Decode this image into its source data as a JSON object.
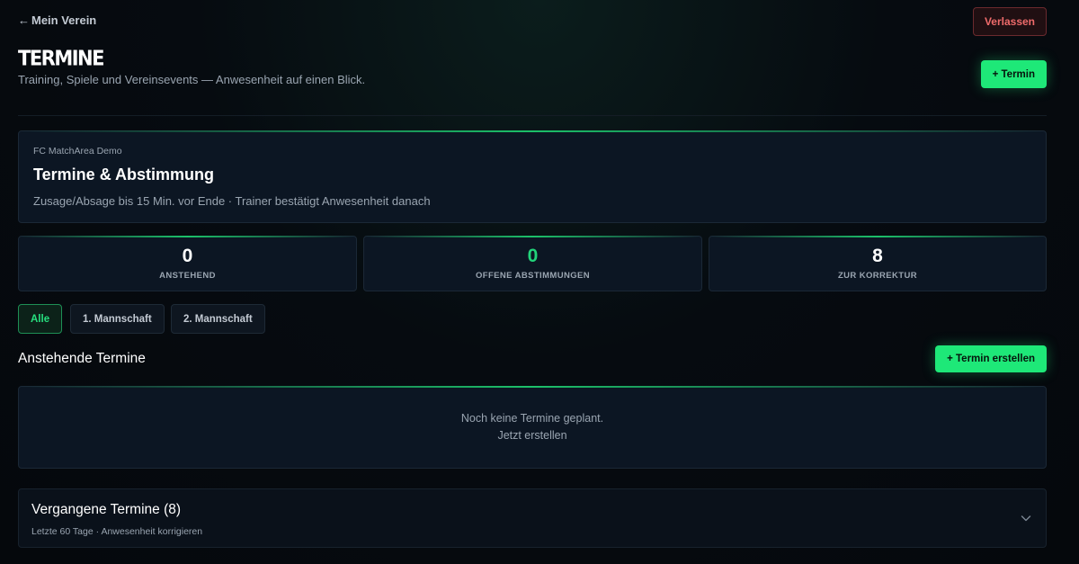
{
  "header": {
    "back_arrow": "←",
    "back_label": "Mein Verein",
    "leave_label": "Verlassen",
    "title": "TERMINE",
    "subtitle": "Training, Spiele und Vereinsevents — Anwesenheit auf einen Blick.",
    "add_label": "+ Termin"
  },
  "info": {
    "org": "FC MatchArea Demo",
    "title": "Termine & Abstimmung",
    "description": "Zusage/Absage bis 15 Min. vor Ende · Trainer bestätigt Anwesenheit danach"
  },
  "stats": [
    {
      "value": "0",
      "label": "ANSTEHEND"
    },
    {
      "value": "0",
      "label": "OFFENE ABSTIMMUNGEN"
    },
    {
      "value": "8",
      "label": "ZUR KORREKTUR"
    }
  ],
  "filters": [
    {
      "label": "Alle",
      "active": true
    },
    {
      "label": "1. Mannschaft",
      "active": false
    },
    {
      "label": "2. Mannschaft",
      "active": false
    }
  ],
  "upcoming": {
    "title": "Anstehende Termine",
    "create_label": "+ Termin erstellen",
    "empty_message": "Noch keine Termine geplant.",
    "empty_link": "Jetzt erstellen"
  },
  "past": {
    "title": "Vergangene Termine (8)",
    "subtitle": "Letzte 60 Tage · Anwesenheit korrigieren",
    "icon": "chevron-down-icon"
  },
  "colors": {
    "accent": "#1ee878",
    "danger": "#ef6b6b",
    "card_bg": "#0c1623",
    "background": "#05080c"
  }
}
